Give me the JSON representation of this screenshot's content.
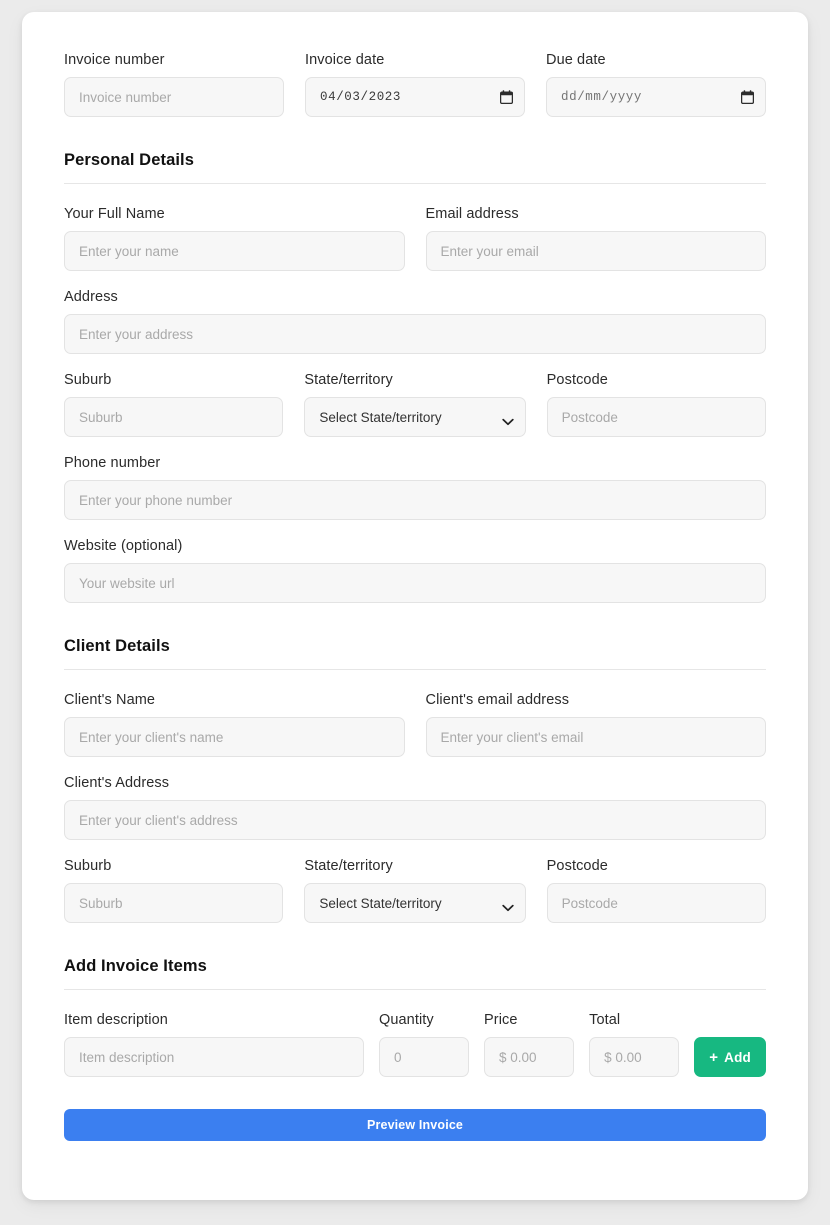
{
  "top_row": {
    "invoice_number": {
      "label": "Invoice number",
      "placeholder": "Invoice number",
      "value": ""
    },
    "invoice_date": {
      "label": "Invoice date",
      "value": "04/03/2023",
      "icon": "calendar-icon"
    },
    "due_date": {
      "label": "Due date",
      "value": "dd/mm/yyyy",
      "icon": "calendar-icon"
    }
  },
  "personal": {
    "heading": "Personal Details",
    "full_name": {
      "label": "Your Full Name",
      "placeholder": "Enter your name",
      "value": ""
    },
    "email": {
      "label": "Email address",
      "placeholder": "Enter your email",
      "value": ""
    },
    "address": {
      "label": "Address",
      "placeholder": "Enter your address",
      "value": ""
    },
    "suburb": {
      "label": "Suburb",
      "placeholder": "Suburb",
      "value": ""
    },
    "state": {
      "label": "State/territory",
      "selected": "Select State/territory",
      "icon": "chevron-down-icon"
    },
    "postcode": {
      "label": "Postcode",
      "placeholder": "Postcode",
      "value": ""
    },
    "phone": {
      "label": "Phone number",
      "placeholder": "Enter your phone number",
      "value": ""
    },
    "website": {
      "label": "Website (optional)",
      "placeholder": "Your website url",
      "value": ""
    }
  },
  "client": {
    "heading": "Client Details",
    "name": {
      "label": "Client's Name",
      "placeholder": "Enter your client's name",
      "value": ""
    },
    "email": {
      "label": "Client's email address",
      "placeholder": "Enter your client's email",
      "value": ""
    },
    "address": {
      "label": "Client's Address",
      "placeholder": "Enter your client's address",
      "value": ""
    },
    "suburb": {
      "label": "Suburb",
      "placeholder": "Suburb",
      "value": ""
    },
    "state": {
      "label": "State/territory",
      "selected": "Select State/territory",
      "icon": "chevron-down-icon"
    },
    "postcode": {
      "label": "Postcode",
      "placeholder": "Postcode",
      "value": ""
    }
  },
  "items": {
    "heading": "Add Invoice Items",
    "description": {
      "label": "Item description",
      "placeholder": "Item description",
      "value": ""
    },
    "quantity": {
      "label": "Quantity",
      "placeholder": "0",
      "value": ""
    },
    "price": {
      "label": "Price",
      "placeholder": "$ 0.00",
      "value": ""
    },
    "total": {
      "label": "Total",
      "placeholder": "$ 0.00",
      "value": ""
    },
    "add_button": {
      "label": "Add",
      "icon": "plus-icon"
    }
  },
  "footer": {
    "preview_button": "Preview Invoice"
  },
  "colors": {
    "page_bg": "#ebebeb",
    "card_bg": "#ffffff",
    "input_bg": "#f7f7f7",
    "input_border": "#e3e3e3",
    "accent_green": "#17b881",
    "accent_blue": "#3b7ff0",
    "placeholder": "#a9a9a9"
  }
}
